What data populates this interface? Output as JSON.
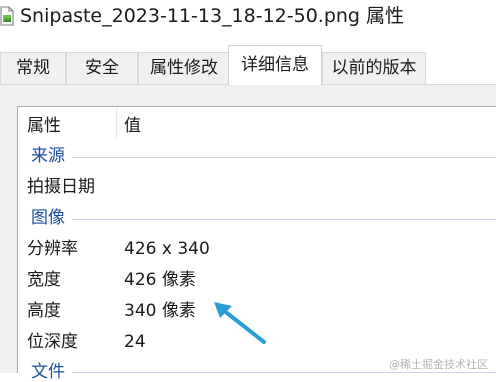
{
  "window": {
    "title": "Snipaste_2023-11-13_18-12-50.png 属性",
    "icon": "image-file-icon"
  },
  "tabs": [
    {
      "label": "常规",
      "active": false
    },
    {
      "label": "安全",
      "active": false
    },
    {
      "label": "属性修改",
      "active": false
    },
    {
      "label": "详细信息",
      "active": true
    },
    {
      "label": "以前的版本",
      "active": false
    }
  ],
  "columns": {
    "name": "属性",
    "value": "值"
  },
  "groups": {
    "source": {
      "title": "来源",
      "rows": [
        {
          "name": "拍摄日期",
          "value": ""
        }
      ]
    },
    "image": {
      "title": "图像",
      "rows": [
        {
          "name": "分辨率",
          "value": "426 x 340"
        },
        {
          "name": "宽度",
          "value": "426 像素"
        },
        {
          "name": "高度",
          "value": "340 像素"
        },
        {
          "name": "位深度",
          "value": "24"
        }
      ]
    },
    "file": {
      "title": "文件"
    }
  },
  "annotation": {
    "arrow_color": "#2a9fd6",
    "icon": "arrow-icon"
  },
  "watermark": "@稀土掘金技术社区",
  "colors": {
    "group_title": "#1e4fa0",
    "tab_active_bg": "#ffffff",
    "tab_bg": "#f0f0f0"
  }
}
